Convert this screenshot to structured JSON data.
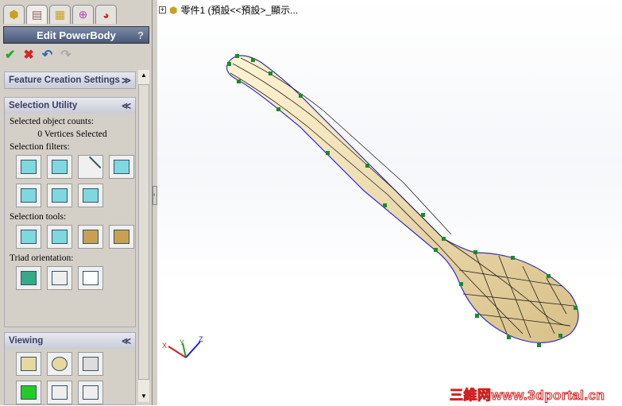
{
  "panel": {
    "tabs": [
      "feature-manager",
      "property-manager",
      "configuration-manager",
      "dimxpert",
      "display-manager"
    ],
    "title": "Edit PowerBody",
    "help": "?",
    "actions": {
      "ok": "✔",
      "cancel": "✖",
      "undo": "↶",
      "redo": "↷"
    },
    "feature_settings": {
      "title": "Feature Creation Settings",
      "chevron": "≫"
    },
    "selection": {
      "title": "Selection Utility",
      "chevron": "≪",
      "counts_label": "Selected object counts:",
      "count_value": "0 Vertices Selected",
      "filters_label": "Selection filters:",
      "tools_label": "Selection tools:",
      "triad_label": "Triad orientation:"
    },
    "viewing": {
      "title": "Viewing",
      "chevron": "≪"
    }
  },
  "tree": {
    "expand": "+",
    "item": "零件1 (預設<<預設>_顯示..."
  },
  "triad": {
    "x": "X",
    "y": "Y",
    "z": "Z"
  },
  "watermark": "三維网www.3dportal.cn"
}
